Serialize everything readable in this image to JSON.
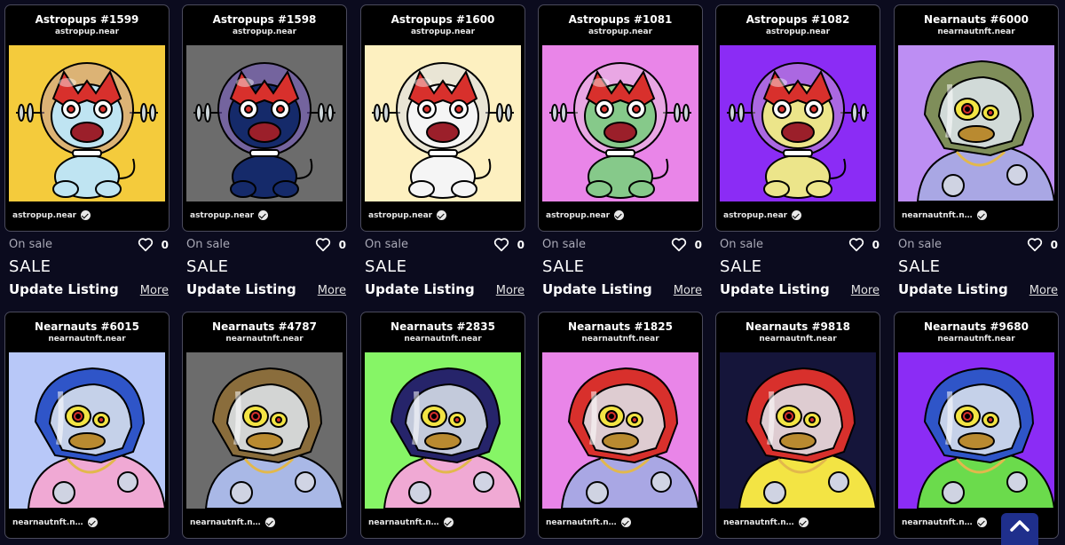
{
  "cards": [
    {
      "title": "Astropups #1599",
      "contract": "astropup.near",
      "owner": "astropup.near",
      "kind": "pup",
      "bg": "#f4cb3c",
      "face": "#bfe4f2",
      "mask": "#d8302c",
      "helmet": "#c9a0a4",
      "status": "On sale",
      "likes": "0",
      "price": "SALE",
      "action": "Update Listing",
      "more": "More"
    },
    {
      "title": "Astropups #1598",
      "contract": "astropup.near",
      "owner": "astropup.near",
      "kind": "pup",
      "bg": "#6c6c6c",
      "face": "#152a6a",
      "mask": "#d8302c",
      "helmet": "#7b5fc8",
      "status": "On sale",
      "likes": "0",
      "price": "SALE",
      "action": "Update Listing",
      "more": "More"
    },
    {
      "title": "Astropups #1600",
      "contract": "astropup.near",
      "owner": "astropup.near",
      "kind": "pup",
      "bg": "#fdf0c0",
      "face": "#f5f5f5",
      "mask": "#d8302c",
      "helmet": "#d9dde5",
      "status": "On sale",
      "likes": "0",
      "price": "SALE",
      "action": "Update Listing",
      "more": "More"
    },
    {
      "title": "Astropups #1081",
      "contract": "astropup.near",
      "owner": "astropup.near",
      "kind": "pup",
      "bg": "#e985e8",
      "face": "#86c98a",
      "mask": "#d8302c",
      "helmet": "#e9c2e0",
      "status": "On sale",
      "likes": "0",
      "price": "SALE",
      "action": "Update Listing",
      "more": "More"
    },
    {
      "title": "Astropups #1082",
      "contract": "astropup.near",
      "owner": "astropup.near",
      "kind": "pup",
      "bg": "#8b2cf5",
      "face": "#ece58a",
      "mask": "#d8302c",
      "helmet": "#c79ad0",
      "status": "On sale",
      "likes": "0",
      "price": "SALE",
      "action": "Update Listing",
      "more": "More"
    },
    {
      "title": "Nearnauts #6000",
      "contract": "nearnautnft.near",
      "owner": "nearnautnft.n…",
      "kind": "naut",
      "bg": "#bd8ef3",
      "suit": "#a9a7e4",
      "helmet": "#7f8e5a",
      "status": "On sale",
      "likes": "0",
      "price": "SALE",
      "action": "Update Listing",
      "more": "More"
    },
    {
      "title": "Nearnauts #6015",
      "contract": "nearnautnft.near",
      "owner": "nearnautnft.n…",
      "kind": "naut",
      "bg": "#b8c8f8",
      "suit": "#f0a9d4",
      "helmet": "#2f55c8"
    },
    {
      "title": "Nearnauts #4787",
      "contract": "nearnautnft.near",
      "owner": "nearnautnft.n…",
      "kind": "naut",
      "bg": "#6c6c6c",
      "suit": "#a9b8e6",
      "helmet": "#8a6d3c"
    },
    {
      "title": "Nearnauts #2835",
      "contract": "nearnautnft.near",
      "owner": "nearnautnft.n…",
      "kind": "naut",
      "bg": "#86f566",
      "suit": "#f0a9d4",
      "helmet": "#26246a"
    },
    {
      "title": "Nearnauts #1825",
      "contract": "nearnautnft.near",
      "owner": "nearnautnft.n…",
      "kind": "naut",
      "bg": "#e985e8",
      "suit": "#a9a7e4",
      "helmet": "#d8302c"
    },
    {
      "title": "Nearnauts #9818",
      "contract": "nearnautnft.near",
      "owner": "nearnautnft.n…",
      "kind": "naut",
      "bg": "#15153a",
      "suit": "#f3e444",
      "helmet": "#d8302c"
    },
    {
      "title": "Nearnauts #9680",
      "contract": "nearnautnft.near",
      "owner": "nearnautnft.n…",
      "kind": "naut",
      "bg": "#8b2cf5",
      "suit": "#6bdb4c",
      "helmet": "#2f55c8"
    }
  ],
  "scroll_top": {
    "icon": "chevron-up-icon"
  }
}
